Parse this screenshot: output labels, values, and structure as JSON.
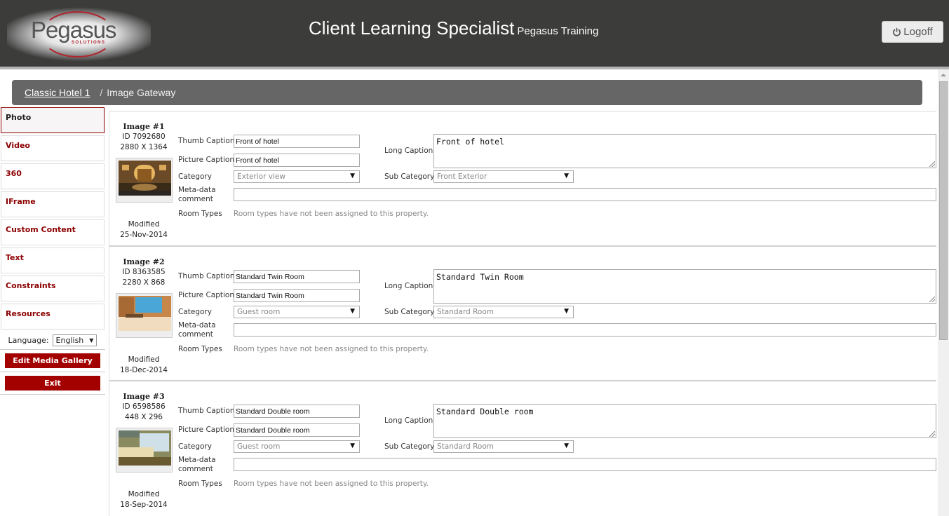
{
  "header": {
    "logo_text": "Pegasus",
    "logo_subtext": "SOLUTIONS",
    "title": "Client Learning Specialist",
    "subtitle": "Pegasus Training",
    "logoff_label": "Logoff",
    "logoff_icon": "power-icon"
  },
  "breadcrumb": {
    "parent": "Classic Hotel 1",
    "separator": "/",
    "current": "Image Gateway"
  },
  "sidebar": {
    "items": [
      {
        "label": "Photo",
        "active": true
      },
      {
        "label": "Video"
      },
      {
        "label": "360"
      },
      {
        "label": "IFrame"
      },
      {
        "label": "Custom Content"
      },
      {
        "label": "Text"
      },
      {
        "label": "Constraints"
      },
      {
        "label": "Resources"
      }
    ],
    "language_label": "Language:",
    "language_value": "English",
    "edit_gallery_label": "Edit Media Gallery",
    "exit_label": "Exit"
  },
  "labels": {
    "thumb_caption": "Thumb Caption",
    "picture_caption": "Picture Caption",
    "category": "Category",
    "meta_data_1": "Meta-data",
    "meta_data_2": "comment",
    "room_types": "Room Types",
    "long_caption": "Long Caption",
    "sub_category": "Sub Category",
    "modified": "Modified",
    "room_types_note": "Room types have not been assigned to this property."
  },
  "images": [
    {
      "title": "Image #1",
      "id": "ID 7092680",
      "dimensions": "2880 X 1364",
      "modified": "25-Nov-2014",
      "thumb_caption": "Front of hotel",
      "picture_caption": "Front of hotel",
      "category": "Exterior view",
      "long_caption": "Front of hotel",
      "sub_category": "Front Exterior",
      "meta_comment": ""
    },
    {
      "title": "Image #2",
      "id": "ID 8363585",
      "dimensions": "2280 X 868",
      "modified": "18-Dec-2014",
      "thumb_caption": "Standard Twin Room",
      "picture_caption": "Standard Twin Room",
      "category": "Guest room",
      "long_caption": "Standard Twin Room",
      "sub_category": "Standard Room",
      "meta_comment": ""
    },
    {
      "title": "Image #3",
      "id": "ID 6598586",
      "dimensions": "448 X 296",
      "modified": "18-Sep-2014",
      "thumb_caption": "Standard Double room",
      "picture_caption": "Standard Double room",
      "category": "Guest room",
      "long_caption": "Standard Double room",
      "sub_category": "Standard Room",
      "meta_comment": ""
    }
  ],
  "colors": {
    "header_bg": "#3c3c3b",
    "accent": "#a30000",
    "sidebar_text": "#8b0000",
    "breadcrumb_bg": "#666666"
  }
}
